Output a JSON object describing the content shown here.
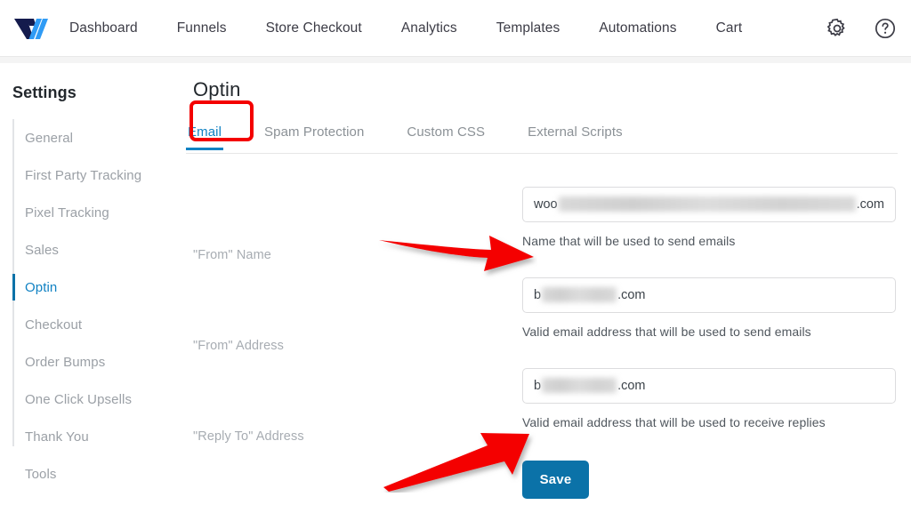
{
  "nav": {
    "logo_name": "funnelkit-logo",
    "links": [
      {
        "label": "Dashboard"
      },
      {
        "label": "Funnels"
      },
      {
        "label": "Store Checkout"
      },
      {
        "label": "Analytics"
      },
      {
        "label": "Templates"
      },
      {
        "label": "Automations"
      },
      {
        "label": "Cart"
      }
    ],
    "icons": [
      {
        "name": "gear-icon"
      },
      {
        "name": "help-icon"
      }
    ]
  },
  "sidebar": {
    "title": "Settings",
    "items": [
      {
        "label": "General",
        "active": false
      },
      {
        "label": "First Party Tracking",
        "active": false
      },
      {
        "label": "Pixel Tracking",
        "active": false
      },
      {
        "label": "Sales",
        "active": false
      },
      {
        "label": "Optin",
        "active": true
      },
      {
        "label": "Checkout",
        "active": false
      },
      {
        "label": "Order Bumps",
        "active": false
      },
      {
        "label": "One Click Upsells",
        "active": false
      },
      {
        "label": "Thank You",
        "active": false
      },
      {
        "label": "Tools",
        "active": false
      }
    ]
  },
  "main": {
    "page_title": "Optin",
    "tabs": [
      {
        "label": "Email",
        "active": true
      },
      {
        "label": "Spam Protection",
        "active": false
      },
      {
        "label": "Custom CSS",
        "active": false
      },
      {
        "label": "External Scripts",
        "active": false
      }
    ],
    "fields": [
      {
        "label": "\"From\" Name",
        "value_prefix": "woo",
        "value_redacted_width": 382,
        "value_suffix": ".com",
        "help": "Name that will be used to send emails"
      },
      {
        "label": "\"From\" Address",
        "value_prefix": "b",
        "value_redacted_width": 84,
        "value_suffix": ".com",
        "help": "Valid email address that will be used to send emails"
      },
      {
        "label": "\"Reply To\" Address",
        "value_prefix": "b",
        "value_redacted_width": 84,
        "value_suffix": ".com",
        "help": "Valid email address that will be used to receive replies"
      }
    ],
    "save_label": "Save"
  },
  "annotations": {
    "highlight_color": "#f40000",
    "arrow_color": "#f40000",
    "arrow_1_target": "\"From\" Name input",
    "arrow_2_target": "\"Reply To\" Address input"
  },
  "colors": {
    "accent_blue": "#1182c3",
    "button_blue": "#0b72a8",
    "annotation_red": "#f40000",
    "text_dark": "#23282d",
    "text_muted": "#9ba0a6"
  }
}
